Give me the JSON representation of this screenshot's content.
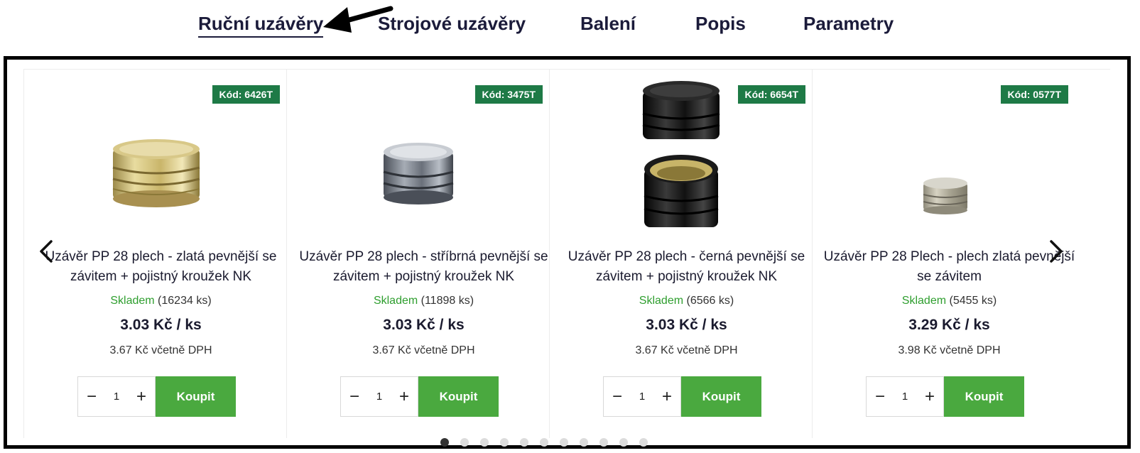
{
  "tabs": [
    {
      "label": "Ruční uzávěry",
      "active": true
    },
    {
      "label": "Strojové uzávěry",
      "active": false
    },
    {
      "label": "Balení",
      "active": false
    },
    {
      "label": "Popis",
      "active": false
    },
    {
      "label": "Parametry",
      "active": false
    }
  ],
  "products": [
    {
      "code": "Kód: 6426T",
      "title": "Uzávěr PP 28 plech - zlatá pevnější se závitem + pojistný kroužek NK",
      "stock_status": "Skladem",
      "stock_count": "(16234 ks)",
      "price": "3.03 Kč / ks",
      "vat_price": "3.67 Kč včetně DPH",
      "quantity": "1",
      "buy_label": "Koupit",
      "cap_color": "gold"
    },
    {
      "code": "Kód: 3475T",
      "title": "Uzávěr PP 28 plech - stříbrná pevnější se závitem + pojistný kroužek NK",
      "stock_status": "Skladem",
      "stock_count": "(11898 ks)",
      "price": "3.03 Kč / ks",
      "vat_price": "3.67 Kč včetně DPH",
      "quantity": "1",
      "buy_label": "Koupit",
      "cap_color": "silver"
    },
    {
      "code": "Kód: 6654T",
      "title": "Uzávěr PP 28 plech - černá pevnější se závitem + pojistný kroužek NK",
      "stock_status": "Skladem",
      "stock_count": "(6566 ks)",
      "price": "3.03 Kč / ks",
      "vat_price": "3.67 Kč včetně DPH",
      "quantity": "1",
      "buy_label": "Koupit",
      "cap_color": "black"
    },
    {
      "code": "Kód: 0577T",
      "title": "Uzávěr PP 28 Plech - plech zlatá pevnější se závitem",
      "stock_status": "Skladem",
      "stock_count": "(5455 ks)",
      "price": "3.29 Kč / ks",
      "vat_price": "3.98 Kč včetně DPH",
      "quantity": "1",
      "buy_label": "Koupit",
      "cap_color": "small-silver"
    }
  ],
  "carousel": {
    "prev_icon": "chevron-left-icon",
    "next_icon": "chevron-right-icon",
    "dot_count": 11,
    "active_dot": 0
  },
  "colors": {
    "badge": "#1e7a46",
    "buy_button": "#4aa93f",
    "in_stock": "#2e9e2e",
    "frame": "#000000"
  },
  "qty_minus": "−",
  "qty_plus": "+"
}
